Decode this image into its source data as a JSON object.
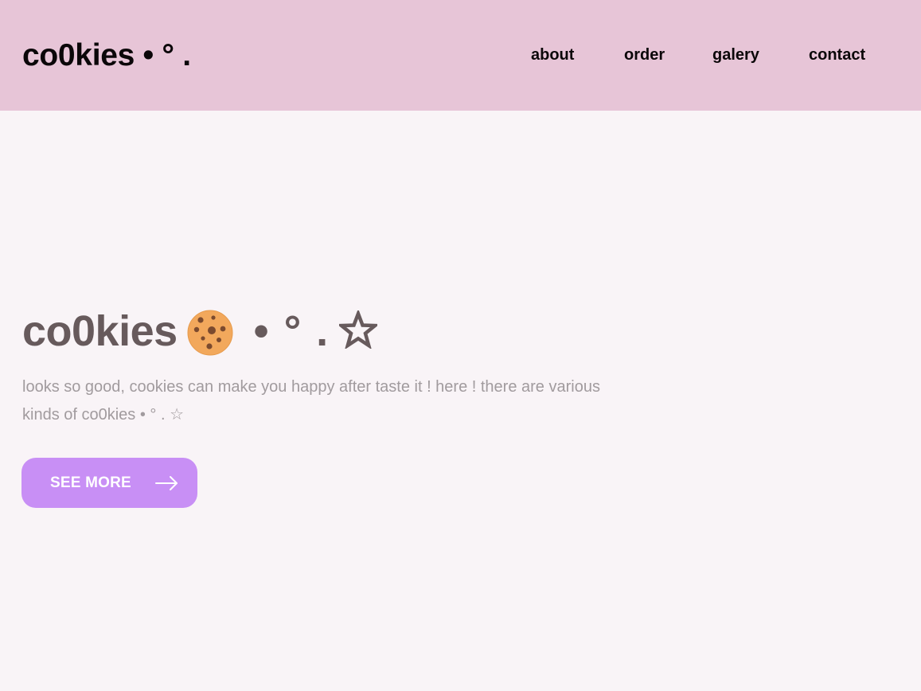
{
  "header": {
    "logo": "co0kies • ° .",
    "nav": [
      {
        "label": "about"
      },
      {
        "label": "order"
      },
      {
        "label": "galery"
      },
      {
        "label": "contact"
      }
    ]
  },
  "hero": {
    "title_word": "co0kies",
    "title_icon": "cookie-icon",
    "title_decoration": "• ° .",
    "title_star_icon": "star-icon",
    "description": "looks so good, cookies can make you happy after taste it ! here ! there are various kinds of co0kies • ° . ☆",
    "button": {
      "label": "SEE MORE",
      "icon": "arrow-right-icon"
    }
  },
  "colors": {
    "header_bg": "#e7c5d7",
    "page_bg": "#f9f4f7",
    "title_text": "#675a5c",
    "desc_text": "#a19b9e",
    "button_bg": "#c88ff5",
    "button_text": "#ffffff",
    "cookie_fill": "#f2a85c",
    "cookie_chips": "#7b4a2e"
  }
}
